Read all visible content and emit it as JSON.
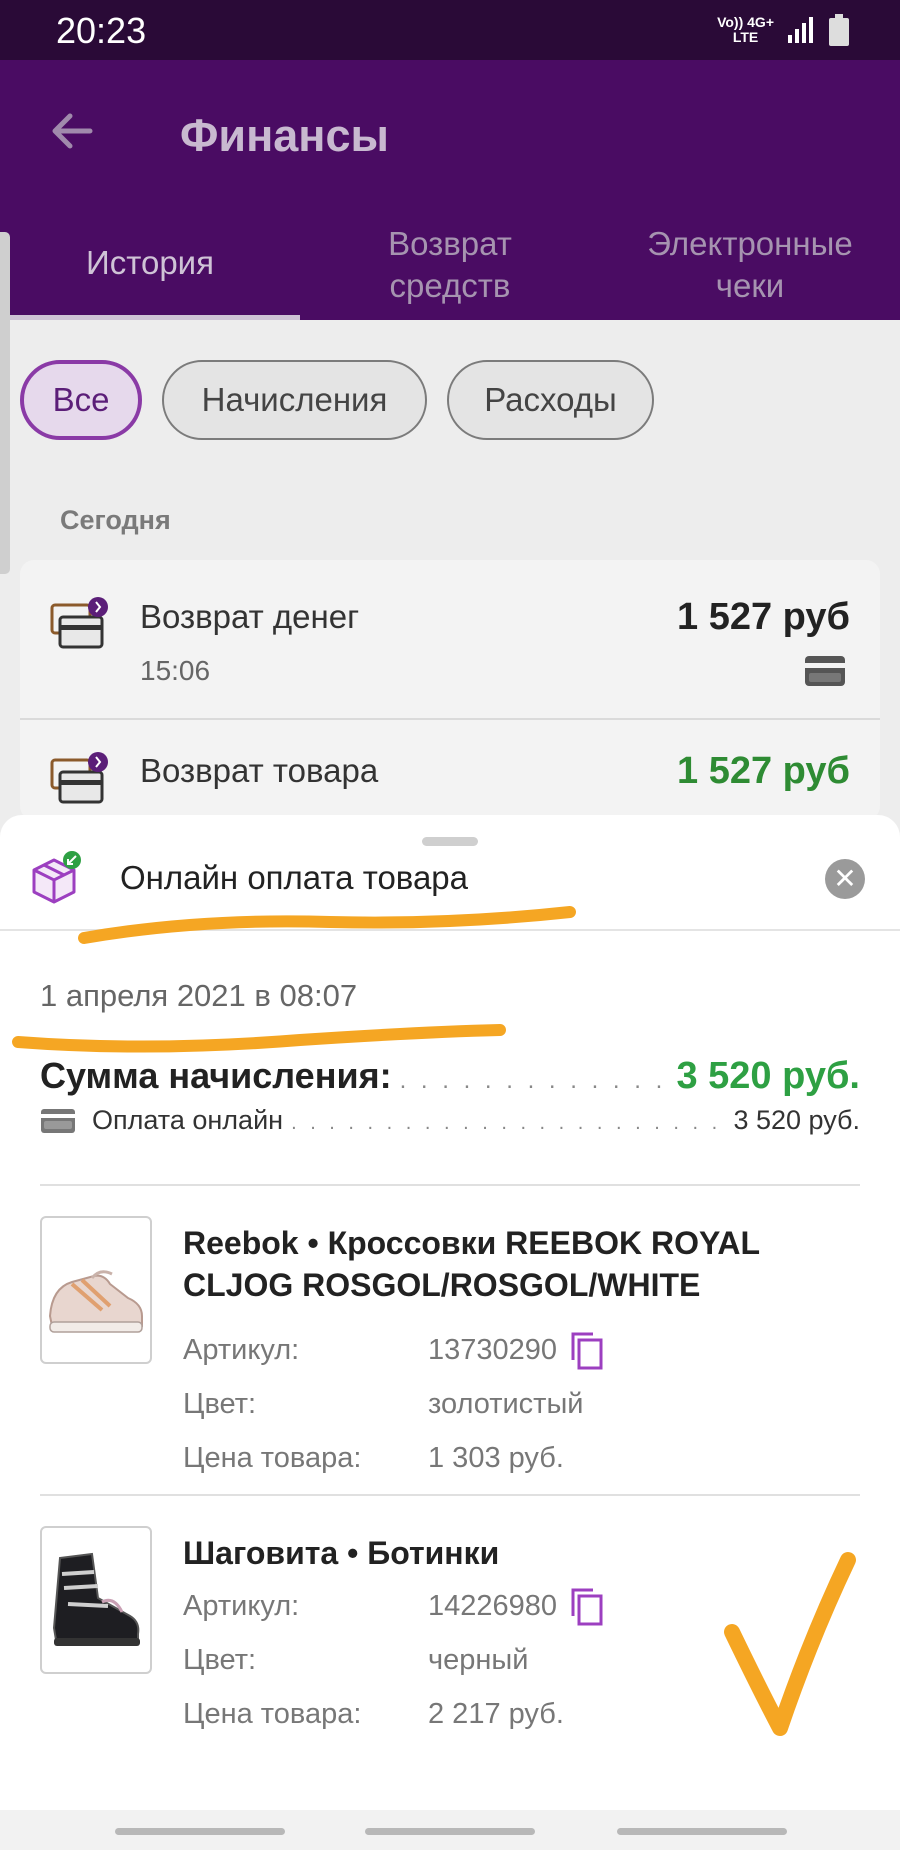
{
  "status_bar": {
    "time": "20:23",
    "network_top": "Vo)) 4G+",
    "network_bottom": "LTE"
  },
  "app_bar": {
    "title": "Финансы"
  },
  "tabs": [
    {
      "label": "История"
    },
    {
      "label": "Возврат средств"
    },
    {
      "label": "Электронные чеки"
    }
  ],
  "filters": [
    {
      "label": "Все"
    },
    {
      "label": "Начисления"
    },
    {
      "label": "Расходы"
    }
  ],
  "section": {
    "today_label": "Сегодня"
  },
  "history": [
    {
      "title": "Возврат денег",
      "time": "15:06",
      "amount": "1 527 руб"
    },
    {
      "title": "Возврат товара",
      "amount": "1 527 руб"
    }
  ],
  "sheet": {
    "title": "Онлайн оплата товара",
    "date": "1 апреля 2021 в 08:07",
    "sum_label": "Сумма начисления:",
    "sum_value": "3 520 руб.",
    "payment_label": "Оплата онлайн",
    "payment_value": "3 520 руб.",
    "attr_labels": {
      "article": "Артикул:",
      "color": "Цвет:",
      "price": "Цена товара:"
    },
    "products": [
      {
        "name": "Reebok • Кроссовки  REEBOK ROYAL CLJOG  ROSGOL/ROSGOL/WHITE",
        "article": "13730290",
        "color": "золотистый",
        "price": "1 303 руб."
      },
      {
        "name": "Шаговита • Ботинки",
        "article": "14226980",
        "color": "черный",
        "price": "2 217 руб."
      }
    ]
  },
  "colors": {
    "primary": "#4a0c63",
    "accent": "#8a3aa6",
    "income": "#2ea043",
    "highlight": "#f5a623"
  }
}
